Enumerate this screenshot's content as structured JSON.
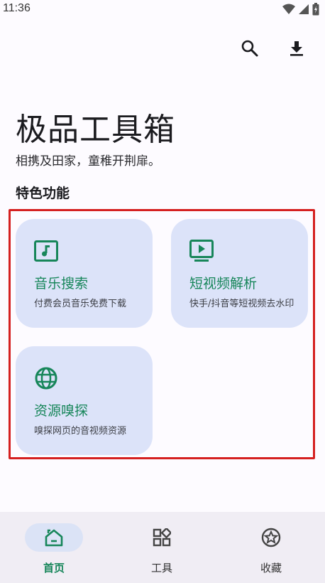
{
  "status_bar": {
    "time": "11:36"
  },
  "top_actions": {
    "search_icon": "search-icon",
    "download_icon": "download-icon"
  },
  "header": {
    "title": "极品工具箱",
    "subtitle": "相携及田家，童稚开荆扉。"
  },
  "section": {
    "title": "特色功能"
  },
  "features": [
    {
      "title": "音乐搜索",
      "description": "付费会员音乐免费下载",
      "icon": "music-note-icon"
    },
    {
      "title": "短视频解析",
      "description": "快手/抖音等短视频去水印",
      "icon": "video-play-icon"
    },
    {
      "title": "资源嗅探",
      "description": "嗅探网页的音视频资源",
      "icon": "globe-icon"
    }
  ],
  "bottom_nav": {
    "items": [
      {
        "label": "首页",
        "icon": "home-icon",
        "active": true
      },
      {
        "label": "工具",
        "icon": "grid-tools-icon",
        "active": false
      },
      {
        "label": "收藏",
        "icon": "star-icon",
        "active": false
      }
    ]
  },
  "colors": {
    "accent": "#17865a",
    "card_bg": "#dce3f9",
    "highlight": "#d52020",
    "nav_bg": "#f0edf4"
  }
}
